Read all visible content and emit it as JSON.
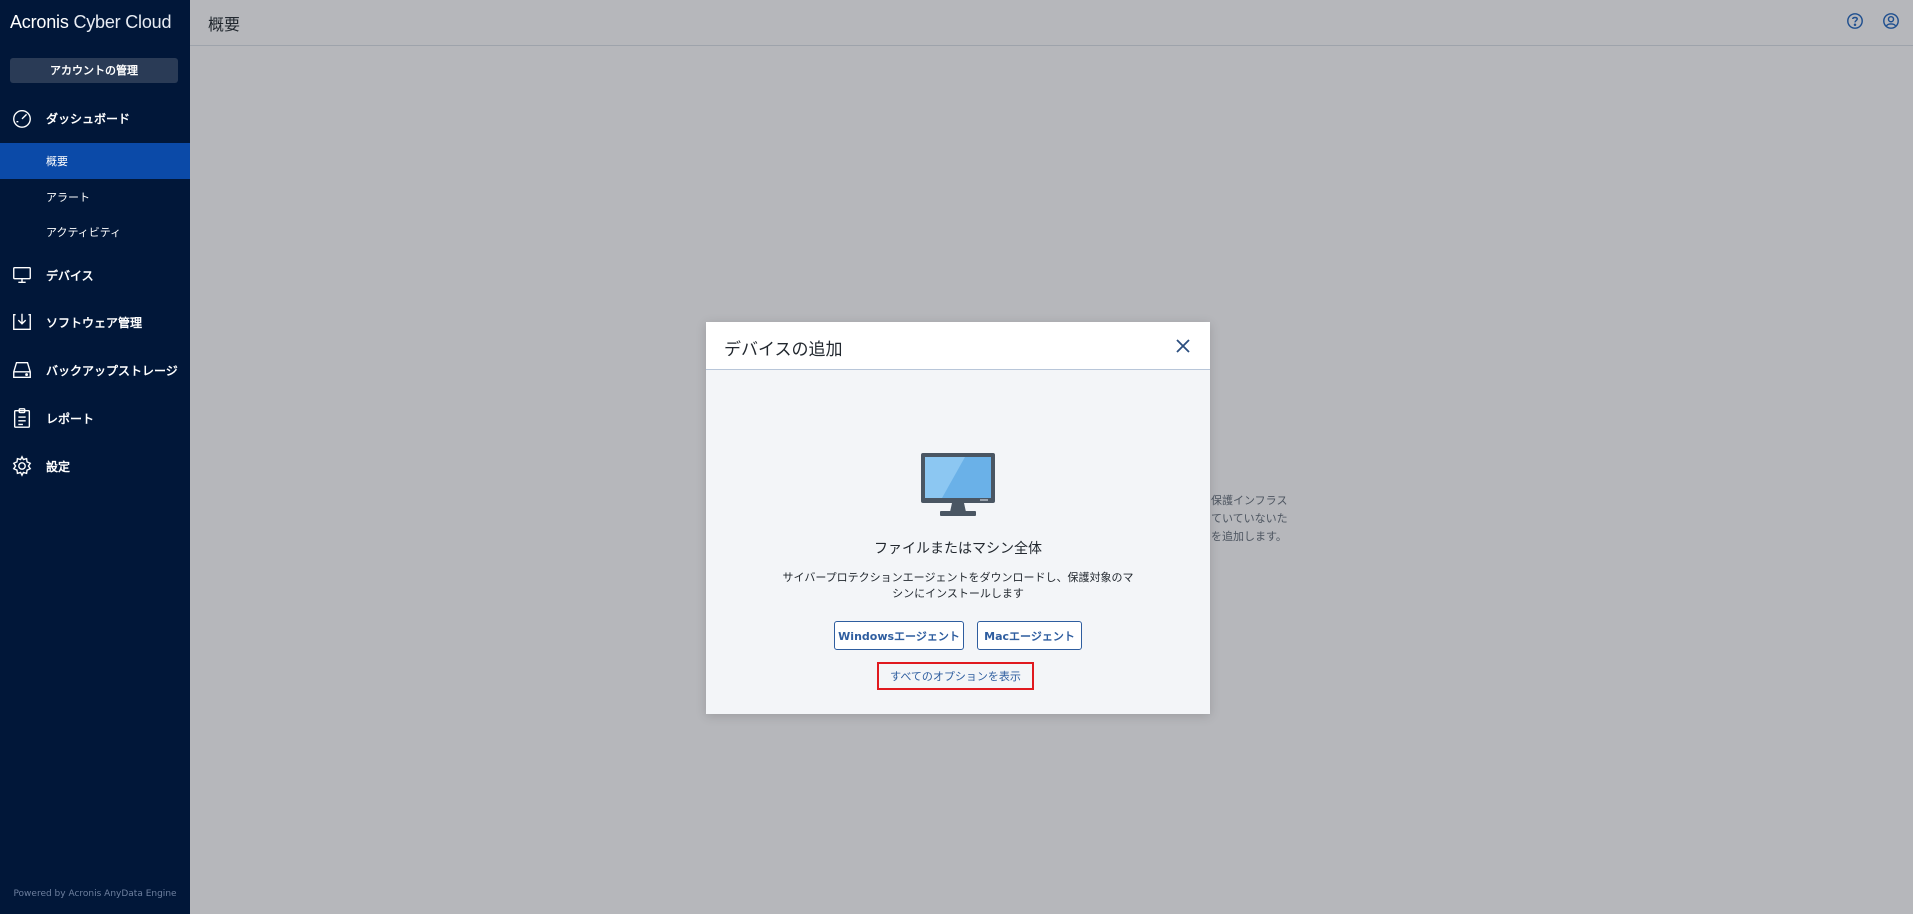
{
  "brand": {
    "name_part1": "Acronis",
    "name_part2": "Cyber Cloud"
  },
  "sidebar": {
    "account_button": "アカウントの管理",
    "items": [
      {
        "label": "ダッシュボード",
        "icon": "dashboard-icon"
      },
      {
        "label": "デバイス",
        "icon": "monitor-icon"
      },
      {
        "label": "ソフトウェア管理",
        "icon": "software-download-icon"
      },
      {
        "label": "バックアップストレージ",
        "icon": "storage-drive-icon"
      },
      {
        "label": "レポート",
        "icon": "clipboard-report-icon"
      },
      {
        "label": "設定",
        "icon": "gear-icon"
      }
    ],
    "subitems": [
      {
        "label": "概要",
        "active": true
      },
      {
        "label": "アラート",
        "active": false
      },
      {
        "label": "アクティビティ",
        "active": false
      }
    ],
    "powered_by": "Powered by Acronis AnyData Engine"
  },
  "topbar": {
    "title": "概要",
    "icons": [
      "help-icon",
      "user-account-icon"
    ]
  },
  "background_text": {
    "lines": [
      "保護インフラス",
      "ていていないた",
      "を追加します。"
    ]
  },
  "modal": {
    "title": "デバイスの追加",
    "option_title": "ファイルまたはマシン全体",
    "option_description": "サイバープロテクションエージェントをダウンロードし、保護対象のマシンにインストールします",
    "windows_button": "Windowsエージェント",
    "mac_button": "Macエージェント",
    "show_all_link": "すべてのオプションを表示"
  },
  "colors": {
    "sidebar_bg": "#011739",
    "sidebar_active": "#0b4aa8",
    "accent": "#2e5d9f",
    "highlight_red": "#e0191f",
    "overlay_bg": "#b6b7bb"
  }
}
